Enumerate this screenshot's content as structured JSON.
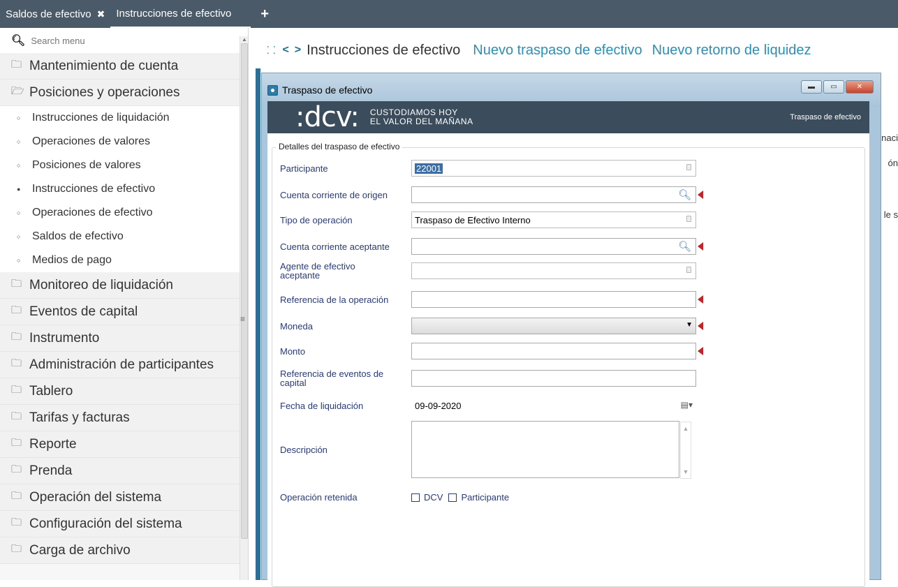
{
  "tabs": [
    {
      "label": "Saldos de efectivo",
      "close": "✖"
    },
    {
      "label": "Instrucciones de efectivo"
    }
  ],
  "tab_add": "+",
  "sidebar": {
    "search_placeholder": "Search menu",
    "groups_top": [
      {
        "label": "Mantenimiento de cuenta"
      },
      {
        "label": "Posiciones y operaciones"
      }
    ],
    "sub_items": [
      {
        "label": "Instrucciones de liquidación"
      },
      {
        "label": "Operaciones de valores"
      },
      {
        "label": "Posiciones de valores"
      },
      {
        "label": "Instrucciones de efectivo"
      },
      {
        "label": "Operaciones de efectivo"
      },
      {
        "label": "Saldos de efectivo"
      },
      {
        "label": "Medios de pago"
      }
    ],
    "groups_bottom": [
      {
        "label": "Monitoreo de liquidación"
      },
      {
        "label": "Eventos de capital"
      },
      {
        "label": "Instrumento"
      },
      {
        "label": "Administración de participantes"
      },
      {
        "label": "Tablero"
      },
      {
        "label": "Tarifas y facturas"
      },
      {
        "label": "Reporte"
      },
      {
        "label": "Prenda"
      },
      {
        "label": "Operación del sistema"
      },
      {
        "label": "Configuración del sistema"
      },
      {
        "label": "Carga de archivo"
      }
    ]
  },
  "header": {
    "title": "Instrucciones de efectivo",
    "link1": "Nuevo traspaso de efectivo",
    "link2": "Nuevo retorno de liquidez"
  },
  "bg_clipped": [
    "naci",
    "ón",
    "le s"
  ],
  "dialog": {
    "title": "Traspaso de efectivo",
    "banner_logo": ":dcv:",
    "banner_tag1": "CUSTODIAMOS HOY",
    "banner_tag2": "EL VALOR DEL MAÑANA",
    "banner_title": "Traspaso de efectivo",
    "legend": "Detalles del traspaso de efectivo",
    "fields": {
      "participante_label": "Participante",
      "participante_value": "22001",
      "cuenta_origen_label": "Cuenta corriente de origen",
      "tipo_label": "Tipo de operación",
      "tipo_value": "Traspaso de Efectivo Interno",
      "cuenta_aceptante_label": "Cuenta corriente aceptante",
      "agente_label": "Agente de efectivo aceptante",
      "referencia_label": "Referencia de la operación",
      "moneda_label": "Moneda",
      "monto_label": "Monto",
      "ref_eventos_label": "Referencia de eventos de capital",
      "fecha_label": "Fecha de liquidación",
      "fecha_value": "09-09-2020",
      "descripcion_label": "Descripción",
      "retenida_label": "Operación retenida",
      "chk_dcv": "DCV",
      "chk_participante": "Participante"
    }
  }
}
